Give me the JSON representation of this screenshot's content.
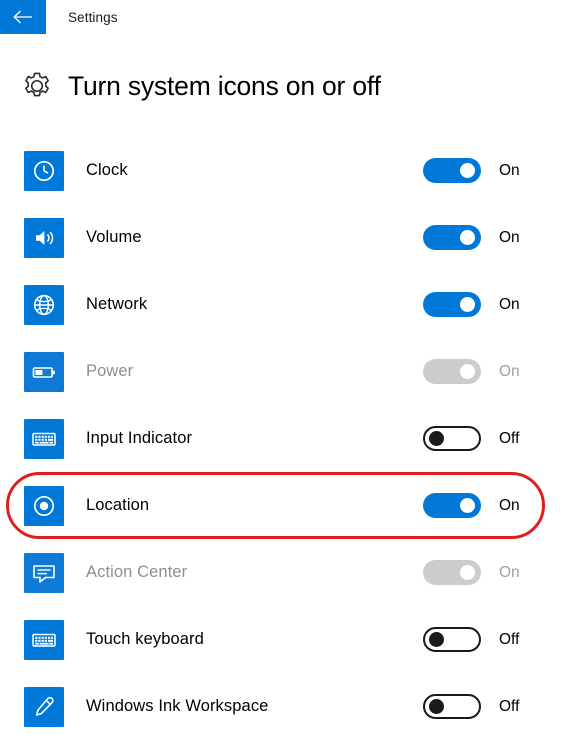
{
  "titlebar": {
    "back_label": "back-arrow",
    "title": "Settings"
  },
  "page": {
    "icon": "gear-icon",
    "title": "Turn system icons on or off"
  },
  "states": {
    "on": "On",
    "off": "Off"
  },
  "rows": [
    {
      "label": "Clock",
      "icon": "clock-icon",
      "state": "On",
      "toggle": "on",
      "disabled": false,
      "highlighted": false
    },
    {
      "label": "Volume",
      "icon": "volume-icon",
      "state": "On",
      "toggle": "on",
      "disabled": false,
      "highlighted": false
    },
    {
      "label": "Network",
      "icon": "globe-icon",
      "state": "On",
      "toggle": "on",
      "disabled": false,
      "highlighted": false
    },
    {
      "label": "Power",
      "icon": "battery-icon",
      "state": "On",
      "toggle": "disabled",
      "disabled": true,
      "highlighted": false
    },
    {
      "label": "Input Indicator",
      "icon": "keyboard-icon",
      "state": "Off",
      "toggle": "off",
      "disabled": false,
      "highlighted": false
    },
    {
      "label": "Location",
      "icon": "location-icon",
      "state": "On",
      "toggle": "on",
      "disabled": false,
      "highlighted": true
    },
    {
      "label": "Action Center",
      "icon": "action-center-icon",
      "state": "On",
      "toggle": "disabled",
      "disabled": true,
      "highlighted": false
    },
    {
      "label": "Touch keyboard",
      "icon": "touch-keyboard-icon",
      "state": "Off",
      "toggle": "off",
      "disabled": false,
      "highlighted": false
    },
    {
      "label": "Windows Ink Workspace",
      "icon": "pen-icon",
      "state": "Off",
      "toggle": "off",
      "disabled": false,
      "highlighted": false
    }
  ],
  "colors": {
    "accent": "#0078d7",
    "highlight": "#e02020",
    "disabled_text": "#a0a0a0"
  }
}
